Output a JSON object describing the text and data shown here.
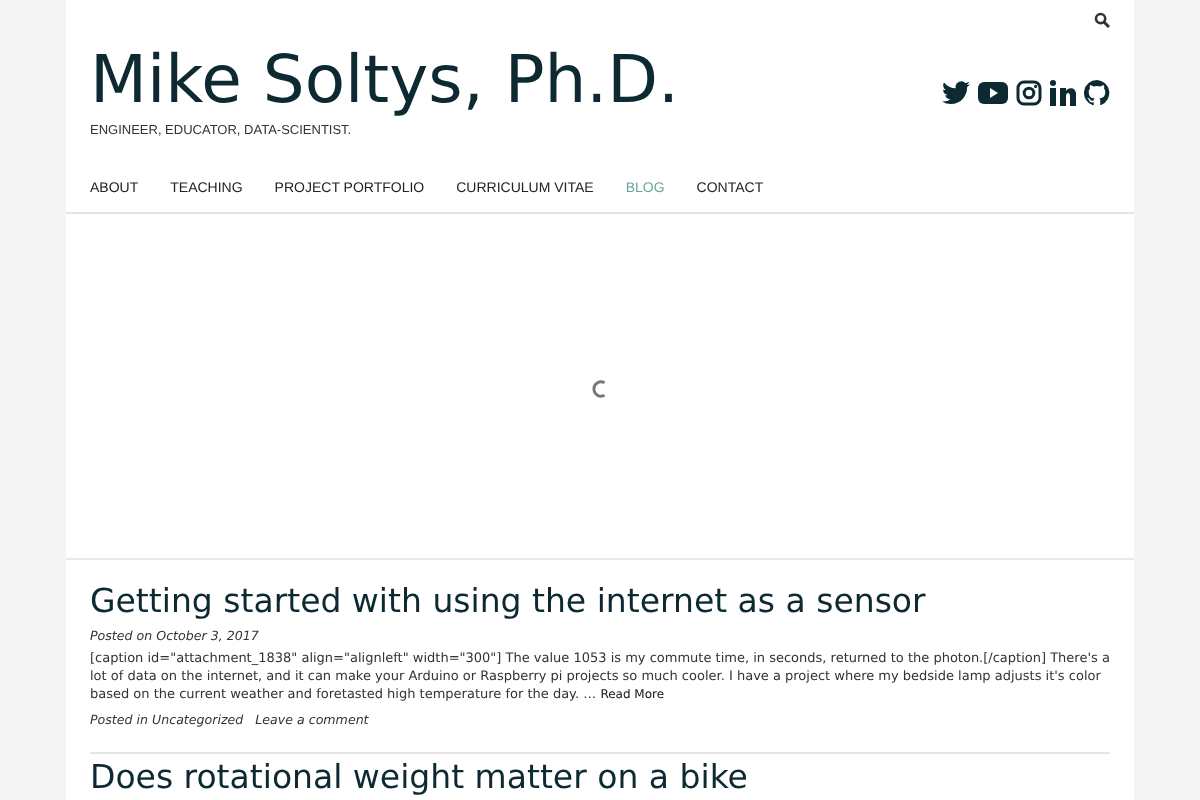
{
  "header": {
    "site_title": "Mike Soltys, Ph.D.",
    "tagline": "ENGINEER, EDUCATOR, DATA-SCIENTIST."
  },
  "nav": [
    {
      "label": "ABOUT",
      "selected": false
    },
    {
      "label": "TEACHING",
      "selected": false
    },
    {
      "label": "PROJECT PORTFOLIO",
      "selected": false
    },
    {
      "label": "CURRICULUM VITAE",
      "selected": false
    },
    {
      "label": "BLOG",
      "selected": true
    },
    {
      "label": "CONTACT",
      "selected": false
    }
  ],
  "posts": [
    {
      "title": "Getting started with using the internet as a sensor",
      "posted_on": "Posted on",
      "date": "October 3, 2017",
      "excerpt": "[caption id=\"attachment_1838\" align=\"alignleft\" width=\"300\"] The value 1053 is my commute time, in seconds, returned to the photon.[/caption] There's a lot of data on the internet, and it can make your Arduino or Raspberry pi projects so much cooler. I have a project where my bedside lamp adjusts it's color based on the current weather and foretasted high temperature for the day. …",
      "read_more": "Read More",
      "posted_in": "Posted in",
      "category": "Uncategorized",
      "comment_link": "Leave a comment"
    },
    {
      "title": "Does rotational weight matter on a bike"
    }
  ]
}
